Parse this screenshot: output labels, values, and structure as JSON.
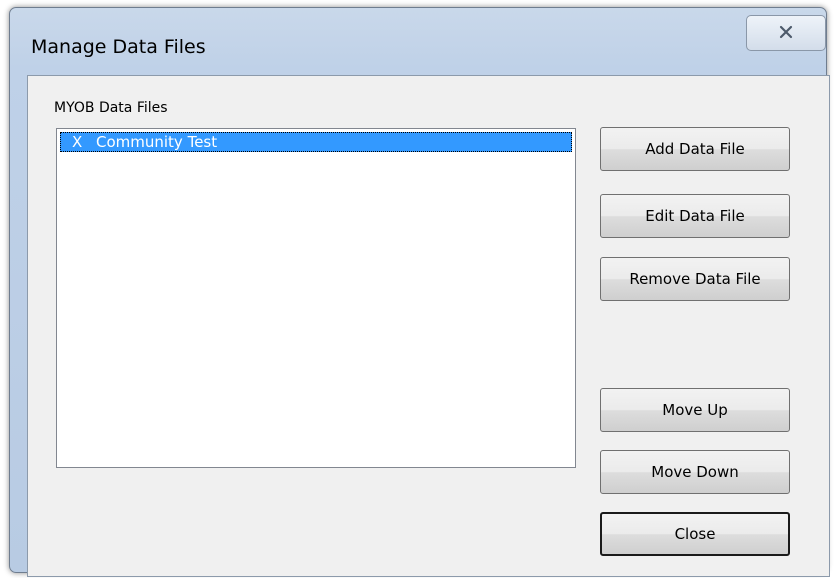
{
  "window": {
    "title": "Manage Data Files"
  },
  "group": {
    "label": "MYOB Data Files"
  },
  "list": {
    "items": [
      {
        "mark": "X",
        "name": "Community Test",
        "selected": true
      }
    ]
  },
  "buttons": {
    "add": "Add Data File",
    "edit": "Edit Data File",
    "remove": "Remove Data File",
    "move_up": "Move Up",
    "move_down": "Move Down",
    "close": "Close"
  },
  "icons": {
    "close": "close-icon"
  },
  "colors": {
    "selection": "#3399ff",
    "frame": "#bfd1e8",
    "client_bg": "#f0f0f0"
  }
}
